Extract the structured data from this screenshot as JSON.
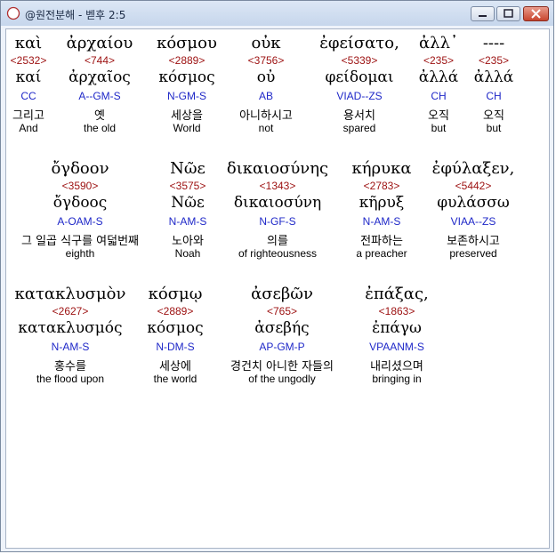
{
  "window": {
    "title": "@원전분해 - 벧후 2:5",
    "icon": "compass-icon",
    "buttons": [
      "minimize",
      "maximize",
      "close"
    ],
    "accent": "#c8452e"
  },
  "verse": [
    [
      {
        "greek": "καὶ",
        "strong": "<2532>",
        "lemma": "καί",
        "parse": "CC",
        "korean": "그리고",
        "english": "And"
      },
      {
        "greek": "ἀρχαίου",
        "strong": "<744>",
        "lemma": "ἀρχαῖος",
        "parse": "A--GM-S",
        "korean": "옛",
        "english": "the old"
      },
      {
        "greek": "κόσμου",
        "strong": "<2889>",
        "lemma": "κόσμος",
        "parse": "N-GM-S",
        "korean": "세상을",
        "english": "World"
      },
      {
        "greek": "οὐκ",
        "strong": "<3756>",
        "lemma": "οὐ",
        "parse": "AB",
        "korean": "아니하시고",
        "english": "not"
      },
      {
        "greek": "ἐφείσατο,",
        "strong": "<5339>",
        "lemma": "φείδομαι",
        "parse": "VIAD--ZS",
        "korean": "용서치",
        "english": "spared"
      },
      {
        "greek": "ἀλλ᾽",
        "strong": "<235>",
        "lemma": "ἀλλά",
        "parse": "CH",
        "korean": "오직",
        "english": "but"
      },
      {
        "greek": "----",
        "strong": "<235>",
        "lemma": "ἀλλά",
        "parse": "CH",
        "korean": "오직",
        "english": "but"
      }
    ],
    [
      {
        "greek": "ὄγδοον",
        "strong": "<3590>",
        "lemma": "ὄγδοος",
        "parse": "A-OAM-S",
        "korean": "그 일곱 식구를 여덟번째",
        "english": "eighth"
      },
      {
        "greek": "Νῶε",
        "strong": "<3575>",
        "lemma": "Νῶε",
        "parse": "N-AM-S",
        "korean": "노아와",
        "english": "Noah"
      },
      {
        "greek": "δικαιοσύνης",
        "strong": "<1343>",
        "lemma": "δικαιοσύνη",
        "parse": "N-GF-S",
        "korean": "의를",
        "english": "of righteousness"
      },
      {
        "greek": "κήρυκα",
        "strong": "<2783>",
        "lemma": "κῆρυξ",
        "parse": "N-AM-S",
        "korean": "전파하는",
        "english": "a preacher"
      },
      {
        "greek": "ἐφύλαξεν,",
        "strong": "<5442>",
        "lemma": "φυλάσσω",
        "parse": "VIAA--ZS",
        "korean": "보존하시고",
        "english": "preserved"
      }
    ],
    [
      {
        "greek": "κατακλυσμὸν",
        "strong": "<2627>",
        "lemma": "κατακλυσμός",
        "parse": "N-AM-S",
        "korean": "홍수를",
        "english": "the flood upon"
      },
      {
        "greek": "κόσμῳ",
        "strong": "<2889>",
        "lemma": "κόσμος",
        "parse": "N-DM-S",
        "korean": "세상에",
        "english": "the world"
      },
      {
        "greek": "ἀσεβῶν",
        "strong": "<765>",
        "lemma": "ἀσεβής",
        "parse": "AP-GM-P",
        "korean": "경건치 아니한 자들의",
        "english": "of the ungodly"
      },
      {
        "greek": "ἐπάξας,",
        "strong": "<1863>",
        "lemma": "ἐπάγω",
        "parse": "VPAANM-S",
        "korean": "내리셨으며",
        "english": "bringing in"
      }
    ]
  ]
}
